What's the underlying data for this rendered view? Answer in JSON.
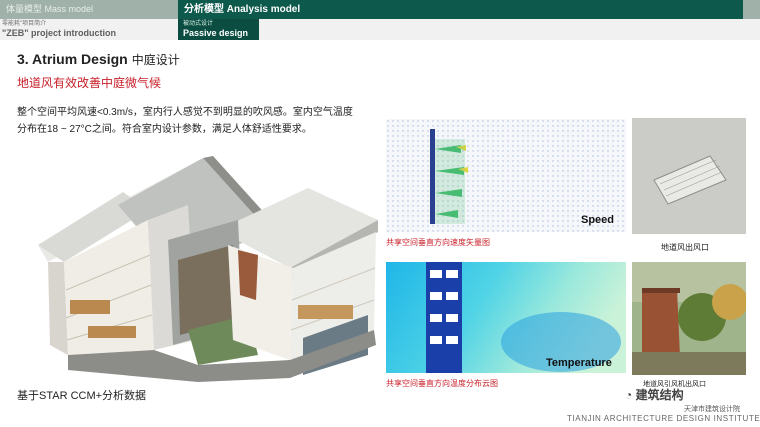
{
  "nav": {
    "tab_mass": "体量模型 Mass model",
    "tab_analysis": "分析模型 Analysis model",
    "sub_zeb_small": "零能耗\"项目简介",
    "sub_zeb_big": "\"ZEB\"  project introduction",
    "sub_passive_small": "被动式设计",
    "sub_passive_big": "Passive design"
  },
  "section": {
    "title": "3.  Atrium Design",
    "title_cn": "中庭设计",
    "subtitle": "地道风有效改善中庭微气候",
    "description": "整个空间平均风速<0.3m/s，室内行人感觉不到明显的吹风感。室内空气温度分布在18 ~ 27°C之间。符合室内设计参数，满足人体舒适性要求。"
  },
  "figures": {
    "building_caption": "基于STAR CCM+分析数据",
    "speed_label": "Speed",
    "speed_caption": "共享空间垂直方向速度矢量图",
    "temperature_label": "Temperature",
    "temperature_caption": "共享空间垂直方向温度分布云图",
    "vent_caption": "地道风出风口",
    "photo_caption": "地道风引风机出风口"
  },
  "branding": {
    "watermark": "建筑结构",
    "institute_cn": "天津市建筑设计院",
    "institute_en": "TIANJIN ARCHITECTURE DESIGN INSTITUTE"
  },
  "colors": {
    "nav_dark": "#0d5a4c",
    "nav_light": "#9fb1a9",
    "accent_red": "#c8202a"
  }
}
